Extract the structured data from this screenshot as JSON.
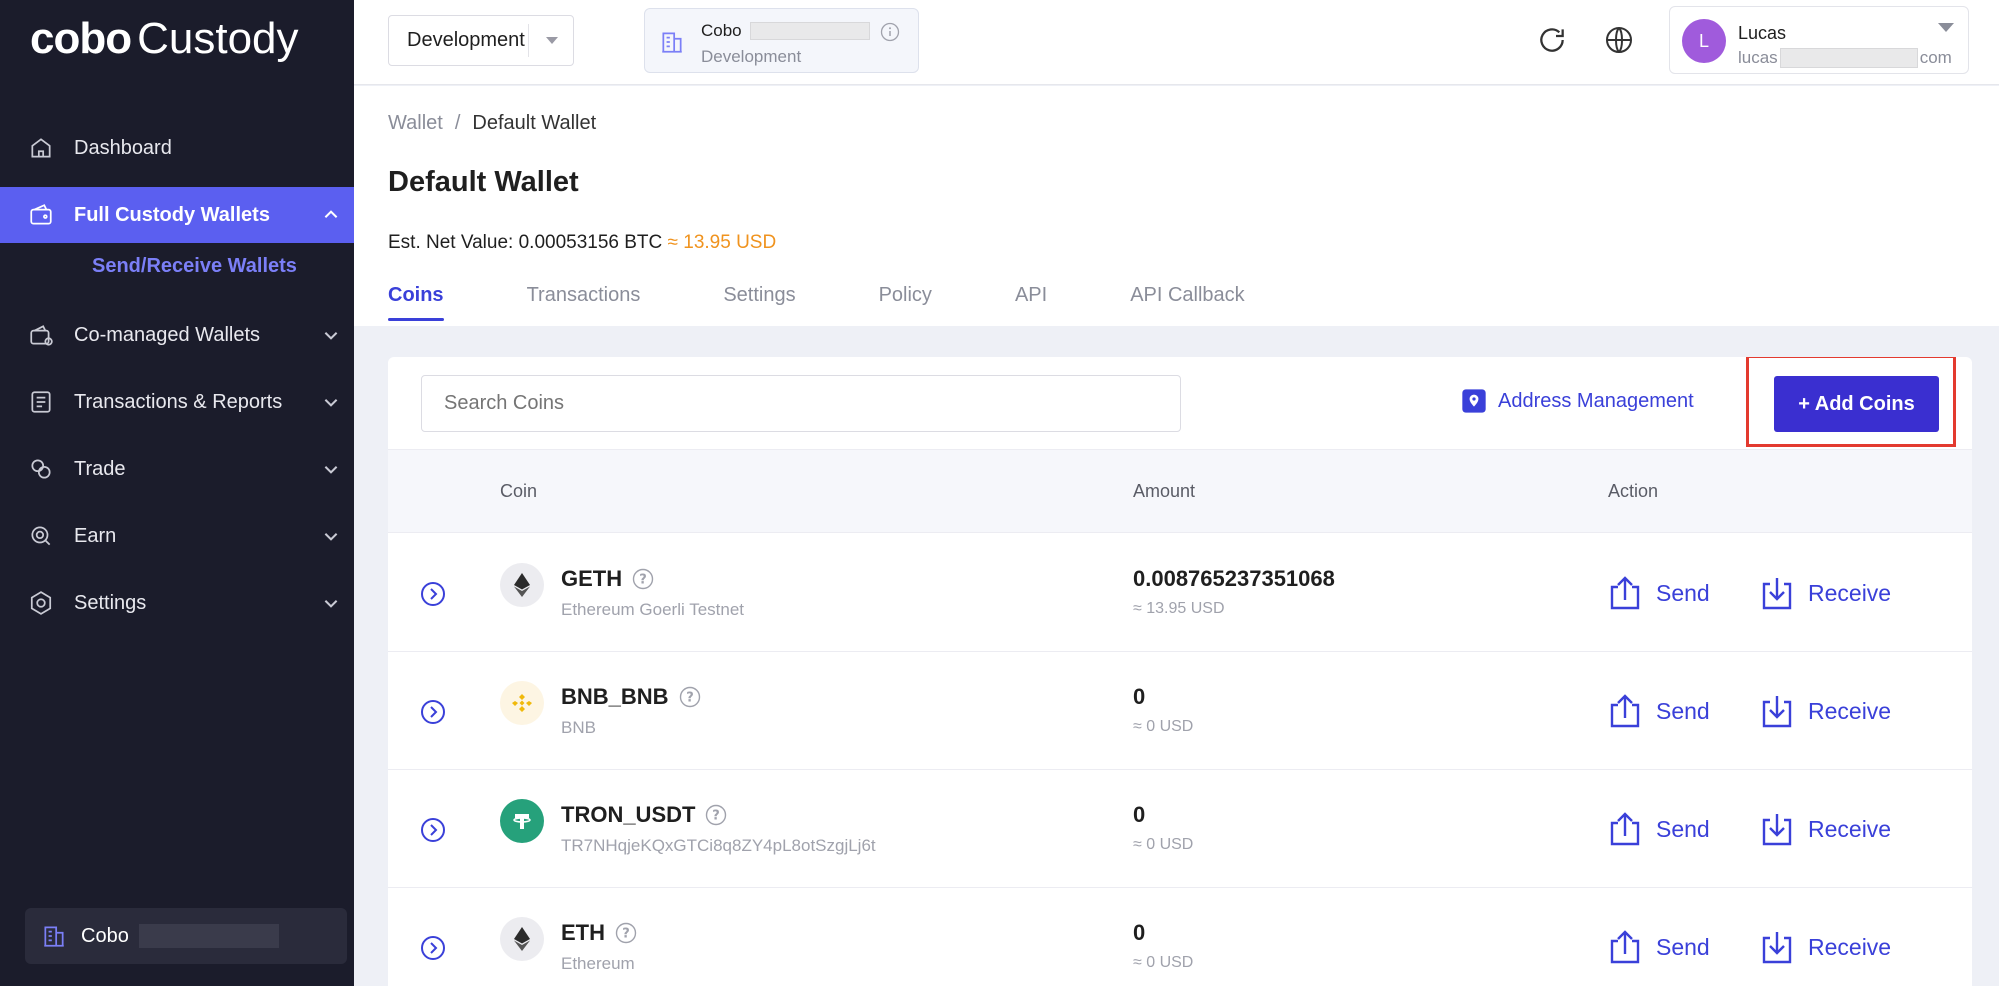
{
  "app": {
    "logo_bold": "cobo",
    "logo_light": "Custody"
  },
  "sidebar": {
    "items": [
      {
        "label": "Dashboard",
        "icon": "home-icon"
      },
      {
        "label": "Full Custody Wallets",
        "icon": "wallet-icon",
        "active": true
      },
      {
        "label": "Co-managed Wallets",
        "icon": "co-managed-wallet-icon"
      },
      {
        "label": "Transactions & Reports",
        "icon": "report-icon"
      },
      {
        "label": "Trade",
        "icon": "trade-icon"
      },
      {
        "label": "Earn",
        "icon": "earn-icon"
      },
      {
        "label": "Settings",
        "icon": "settings-icon"
      }
    ],
    "sub_item": "Send/Receive Wallets",
    "org_name": "Cobo"
  },
  "header": {
    "env_select": "Development",
    "org_card": {
      "name": "Cobo",
      "env": "Development"
    },
    "user": {
      "initial": "L",
      "name": "Lucas",
      "email_prefix": "lucas",
      "email_suffix": "com"
    }
  },
  "page": {
    "breadcrumb": [
      "Wallet",
      "Default Wallet"
    ],
    "breadcrumb_sep": "/",
    "title": "Default Wallet",
    "net_value_label": "Est. Net Value: 0.00053156 BTC",
    "net_value_usd": "≈ 13.95 USD",
    "tabs": [
      "Coins",
      "Transactions",
      "Settings",
      "Policy",
      "API",
      "API Callback"
    ]
  },
  "toolbar": {
    "search_placeholder": "Search Coins",
    "address_management": "Address Management",
    "add_coins": "+ Add Coins"
  },
  "table": {
    "columns": [
      "Coin",
      "Amount",
      "Action"
    ],
    "send_label": "Send",
    "receive_label": "Receive",
    "rows": [
      {
        "symbol": "GETH",
        "name": "Ethereum Goerli Testnet",
        "amount": "0.008765237351068",
        "usd": "≈ 13.95 USD",
        "icon": "ethereum-icon",
        "icon_bg": "#ececf0"
      },
      {
        "symbol": "BNB_BNB",
        "name": "BNB",
        "amount": "0",
        "usd": "≈ 0 USD",
        "icon": "bnb-icon",
        "icon_bg": "#fdf5e3"
      },
      {
        "symbol": "TRON_USDT",
        "name": "TR7NHqjeKQxGTCi8q8ZY4pL8otSzgjLj6t",
        "amount": "0",
        "usd": "≈ 0 USD",
        "icon": "tether-icon",
        "icon_bg": "#26a17b"
      },
      {
        "symbol": "ETH",
        "name": "Ethereum",
        "amount": "0",
        "usd": "≈ 0 USD",
        "icon": "ethereum-icon",
        "icon_bg": "#ececf0"
      }
    ]
  },
  "colors": {
    "sidebar_bg": "#1b1c2b",
    "accent": "#3a40d9",
    "active_nav": "#5b5ff0",
    "usd_orange": "#f0931e",
    "highlight_red": "#e33a2f"
  }
}
